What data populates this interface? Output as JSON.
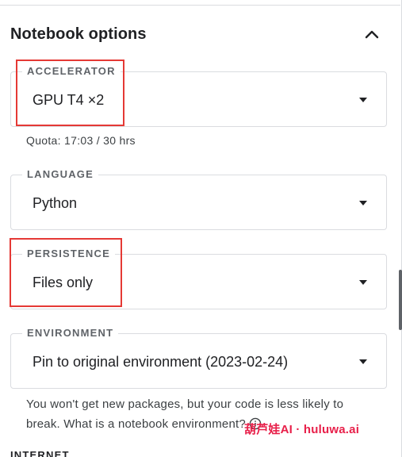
{
  "panel": {
    "title": "Notebook options",
    "collapse_icon": "chevron-up-icon"
  },
  "accelerator": {
    "label": "ACCELERATOR",
    "value": "GPU T4 ×2",
    "quota": "Quota: 17:03 / 30 hrs"
  },
  "language": {
    "label": "LANGUAGE",
    "value": "Python"
  },
  "persistence": {
    "label": "PERSISTENCE",
    "value": "Files only"
  },
  "environment": {
    "label": "ENVIRONMENT",
    "value": "Pin to original environment (2023-02-24)",
    "help": "You won't get new packages, but your code is less likely to break. What is a notebook environment?"
  },
  "next_section": {
    "label": "INTERNET"
  },
  "watermark": {
    "text": "葫芦娃AI · huluwa.ai"
  },
  "colors": {
    "highlight": "#e53935",
    "watermark": "#e8204a",
    "border": "#dadce0"
  }
}
